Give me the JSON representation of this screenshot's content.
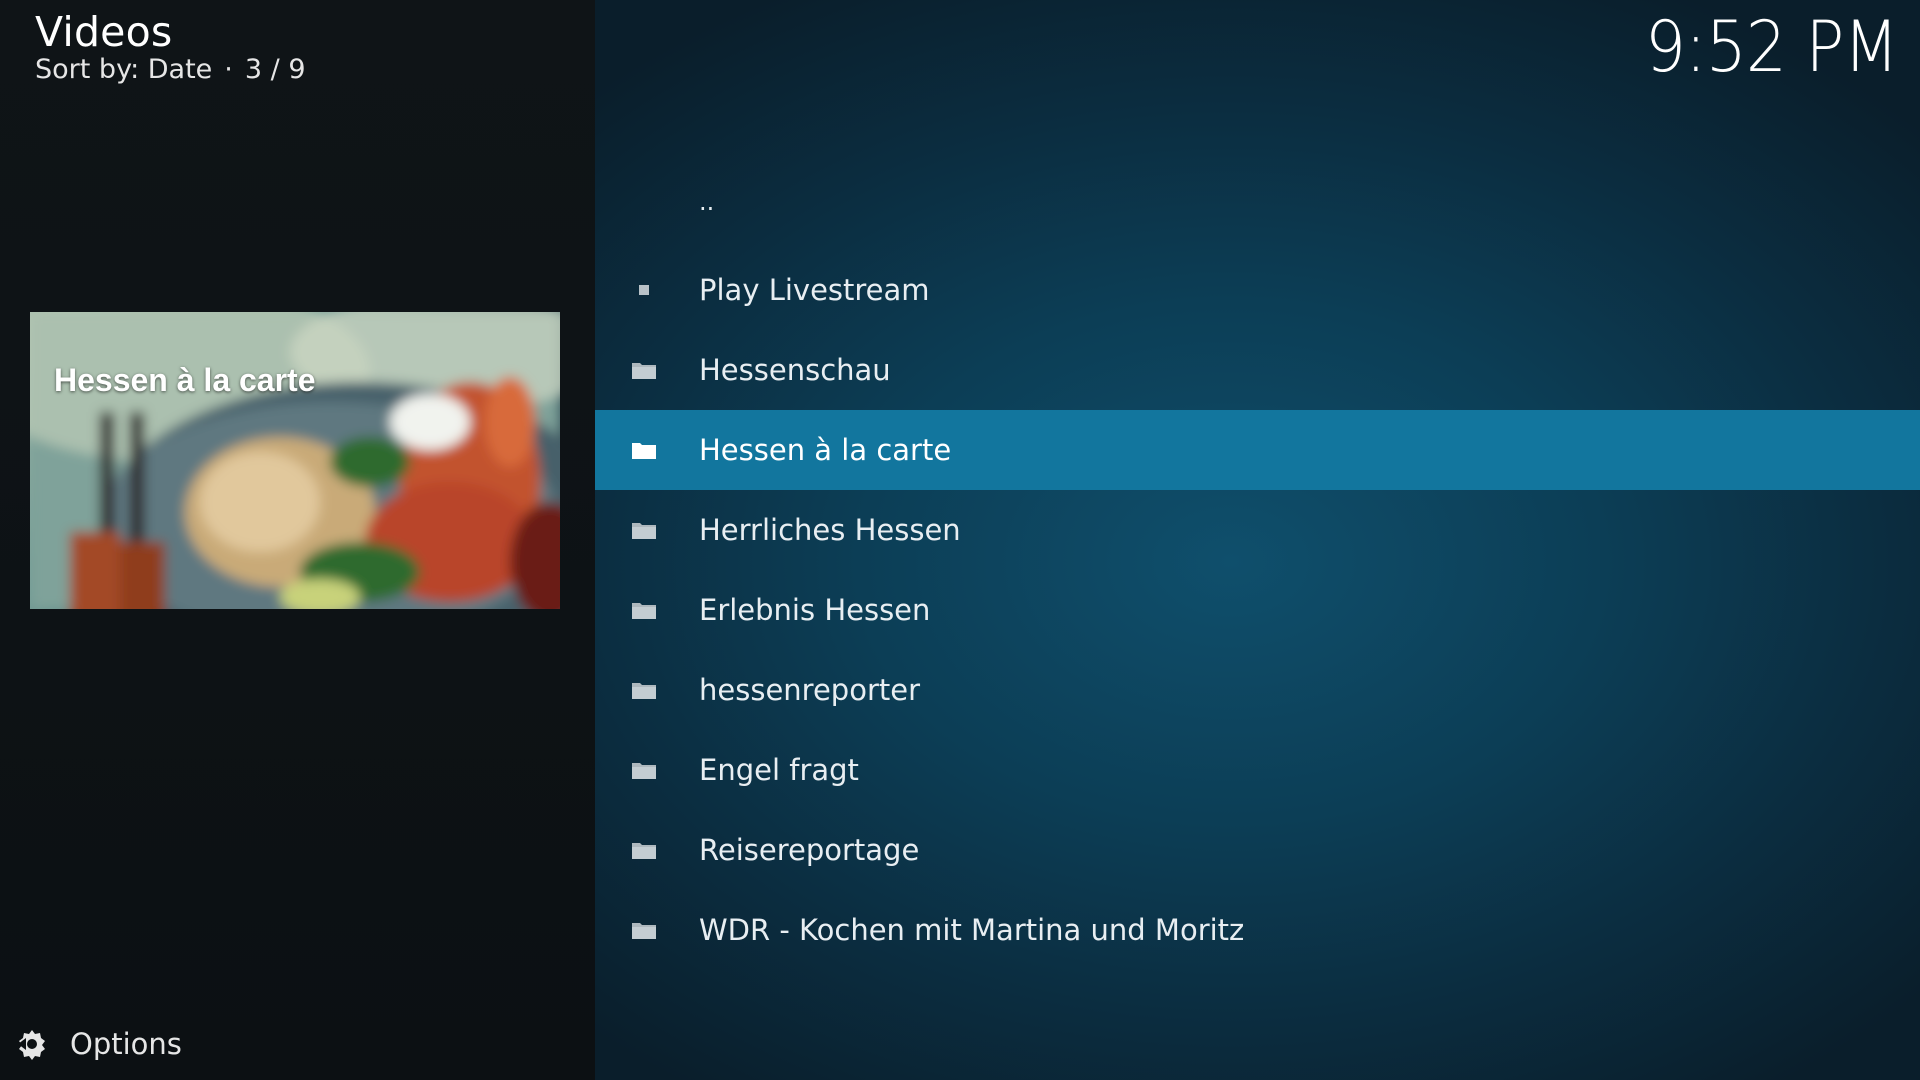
{
  "header": {
    "title": "Videos",
    "sort_label": "Sort by: Date",
    "separator": "·",
    "position": "3 / 9"
  },
  "clock": "9:52 PM",
  "thumbnail": {
    "caption": "Hessen à la carte"
  },
  "list": {
    "items": [
      {
        "label": "..",
        "icon": "none"
      },
      {
        "label": "Play Livestream",
        "icon": "square-icon"
      },
      {
        "label": "Hessenschau",
        "icon": "folder-icon"
      },
      {
        "label": "Hessen à la carte",
        "icon": "folder-icon",
        "selected": true
      },
      {
        "label": "Herrliches Hessen",
        "icon": "folder-icon"
      },
      {
        "label": "Erlebnis Hessen",
        "icon": "folder-icon"
      },
      {
        "label": "hessenreporter",
        "icon": "folder-icon"
      },
      {
        "label": "Engel fragt",
        "icon": "folder-icon"
      },
      {
        "label": "Reisereportage",
        "icon": "folder-icon"
      },
      {
        "label": "WDR - Kochen mit Martina und Moritz",
        "icon": "folder-icon"
      }
    ]
  },
  "footer": {
    "options_label": "Options"
  },
  "colors": {
    "accent_selected": "#12769e",
    "left_panel_bg": "#0f1417",
    "right_panel_bg": "#0c3e56"
  }
}
